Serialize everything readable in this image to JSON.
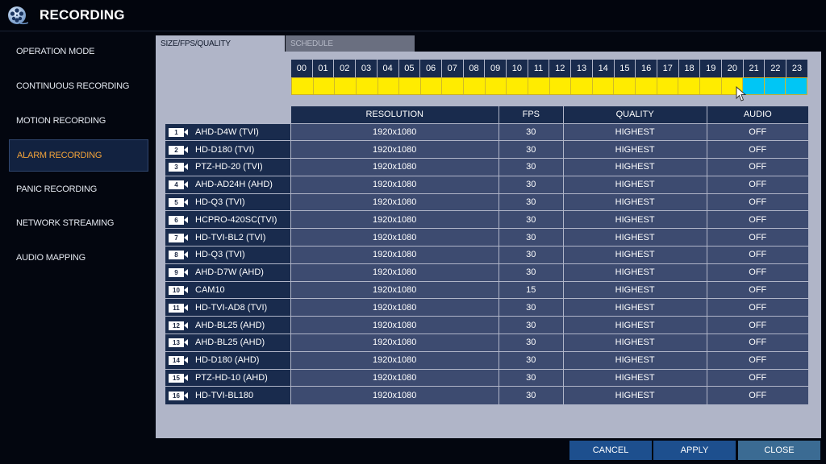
{
  "window": {
    "title": "RECORDING",
    "icon": "film-reel-icon"
  },
  "sidebar": {
    "items": [
      {
        "label": "OPERATION MODE",
        "active": false
      },
      {
        "label": "CONTINUOUS RECORDING",
        "active": false
      },
      {
        "label": "MOTION RECORDING",
        "active": false
      },
      {
        "label": "ALARM RECORDING",
        "active": true
      },
      {
        "label": "PANIC RECORDING",
        "active": false
      },
      {
        "label": "NETWORK STREAMING",
        "active": false
      },
      {
        "label": "AUDIO MAPPING",
        "active": false
      }
    ]
  },
  "tabs": [
    {
      "label": "SIZE/FPS/QUALITY",
      "active": true
    },
    {
      "label": "SCHEDULE",
      "active": false
    }
  ],
  "schedule": {
    "hours": [
      "00",
      "01",
      "02",
      "03",
      "04",
      "05",
      "06",
      "07",
      "08",
      "09",
      "10",
      "11",
      "12",
      "13",
      "14",
      "15",
      "16",
      "17",
      "18",
      "19",
      "20",
      "21",
      "22",
      "23"
    ],
    "states": [
      "yellow",
      "yellow",
      "yellow",
      "yellow",
      "yellow",
      "yellow",
      "yellow",
      "yellow",
      "yellow",
      "yellow",
      "yellow",
      "yellow",
      "yellow",
      "yellow",
      "yellow",
      "yellow",
      "yellow",
      "yellow",
      "yellow",
      "yellow",
      "yellow",
      "cyan",
      "cyan",
      "cyan"
    ],
    "colors": {
      "yellow": "#ffec00",
      "cyan": "#00c6f5"
    }
  },
  "table": {
    "headers": [
      "RESOLUTION",
      "FPS",
      "QUALITY",
      "AUDIO"
    ],
    "rows": [
      {
        "num": "1",
        "camera": "AHD-D4W (TVI)",
        "resolution": "1920x1080",
        "fps": "30",
        "quality": "HIGHEST",
        "audio": "OFF"
      },
      {
        "num": "2",
        "camera": "HD-D180 (TVI)",
        "resolution": "1920x1080",
        "fps": "30",
        "quality": "HIGHEST",
        "audio": "OFF"
      },
      {
        "num": "3",
        "camera": "PTZ-HD-20 (TVI)",
        "resolution": "1920x1080",
        "fps": "30",
        "quality": "HIGHEST",
        "audio": "OFF"
      },
      {
        "num": "4",
        "camera": "AHD-AD24H (AHD)",
        "resolution": "1920x1080",
        "fps": "30",
        "quality": "HIGHEST",
        "audio": "OFF"
      },
      {
        "num": "5",
        "camera": "HD-Q3 (TVI)",
        "resolution": "1920x1080",
        "fps": "30",
        "quality": "HIGHEST",
        "audio": "OFF"
      },
      {
        "num": "6",
        "camera": "HCPRO-420SC(TVI)",
        "resolution": "1920x1080",
        "fps": "30",
        "quality": "HIGHEST",
        "audio": "OFF"
      },
      {
        "num": "7",
        "camera": "HD-TVI-BL2 (TVI)",
        "resolution": "1920x1080",
        "fps": "30",
        "quality": "HIGHEST",
        "audio": "OFF"
      },
      {
        "num": "8",
        "camera": "HD-Q3 (TVI)",
        "resolution": "1920x1080",
        "fps": "30",
        "quality": "HIGHEST",
        "audio": "OFF"
      },
      {
        "num": "9",
        "camera": "AHD-D7W (AHD)",
        "resolution": "1920x1080",
        "fps": "30",
        "quality": "HIGHEST",
        "audio": "OFF"
      },
      {
        "num": "10",
        "camera": "CAM10",
        "resolution": "1920x1080",
        "fps": "15",
        "quality": "HIGHEST",
        "audio": "OFF"
      },
      {
        "num": "11",
        "camera": "HD-TVI-AD8 (TVI)",
        "resolution": "1920x1080",
        "fps": "30",
        "quality": "HIGHEST",
        "audio": "OFF"
      },
      {
        "num": "12",
        "camera": "AHD-BL25 (AHD)",
        "resolution": "1920x1080",
        "fps": "30",
        "quality": "HIGHEST",
        "audio": "OFF"
      },
      {
        "num": "13",
        "camera": "AHD-BL25 (AHD)",
        "resolution": "1920x1080",
        "fps": "30",
        "quality": "HIGHEST",
        "audio": "OFF"
      },
      {
        "num": "14",
        "camera": "HD-D180 (AHD)",
        "resolution": "1920x1080",
        "fps": "30",
        "quality": "HIGHEST",
        "audio": "OFF"
      },
      {
        "num": "15",
        "camera": "PTZ-HD-10 (AHD)",
        "resolution": "1920x1080",
        "fps": "30",
        "quality": "HIGHEST",
        "audio": "OFF"
      },
      {
        "num": "16",
        "camera": "HD-TVI-BL180",
        "resolution": "1920x1080",
        "fps": "30",
        "quality": "HIGHEST",
        "audio": "OFF"
      }
    ]
  },
  "buttons": {
    "cancel": "CANCEL",
    "apply": "APPLY",
    "close": "CLOSE"
  }
}
